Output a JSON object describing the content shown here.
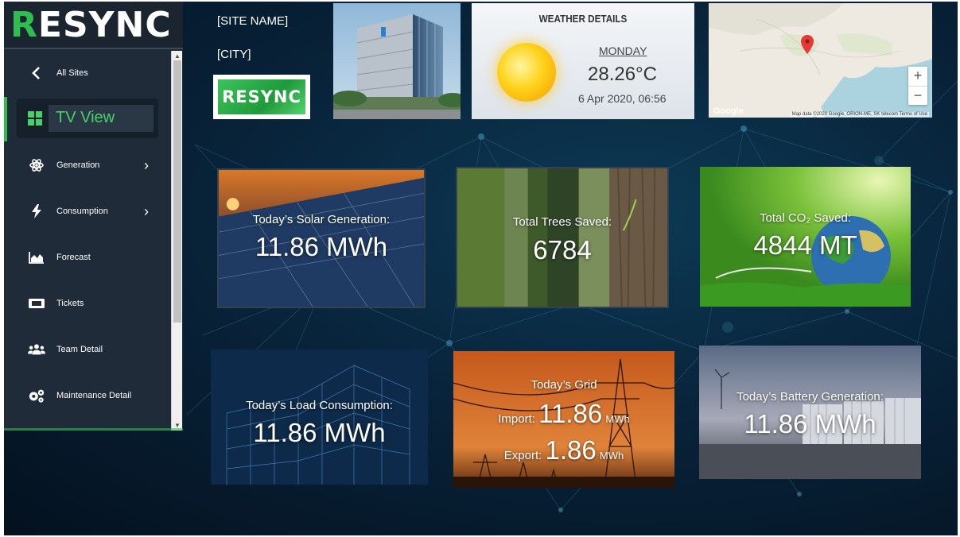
{
  "brand": {
    "logo_text": "RESYNC",
    "logo_first_letter": "R",
    "logo_rest": "ESYNC",
    "accent": "#2ebd4e"
  },
  "sidebar": {
    "items": [
      {
        "label": "All Sites",
        "icon": "chevron-left-icon"
      },
      {
        "label": "TV View",
        "icon": "grid-icon",
        "active": true
      },
      {
        "label": "Generation",
        "icon": "atom-icon",
        "has_submenu": true
      },
      {
        "label": "Consumption",
        "icon": "bolt-icon",
        "has_submenu": true
      },
      {
        "label": "Forecast",
        "icon": "area-chart-icon"
      },
      {
        "label": "Tickets",
        "icon": "ticket-icon"
      },
      {
        "label": "Team Detail",
        "icon": "users-icon"
      },
      {
        "label": "Maintenance Detail",
        "icon": "cogs-icon"
      }
    ]
  },
  "site": {
    "name": "[SITE NAME]",
    "city": "[CITY]",
    "logo_text": "RESYNC"
  },
  "weather": {
    "title": "WEATHER DETAILS",
    "day": "MONDAY",
    "temperature": "28.26°C",
    "datetime": "6 Apr 2020, 06:56",
    "icon": "sun-icon"
  },
  "map": {
    "google_label": "Google",
    "attribution": "Map data ©2020 Google, ORION-ME, SK telecom   Terms of Use",
    "zoom_in": "+",
    "zoom_out": "−"
  },
  "stats": {
    "solar": {
      "label": "Today’s Solar Generation:",
      "value": "11.86 MWh"
    },
    "trees": {
      "label": "Total Trees Saved:",
      "value": "6784"
    },
    "co2": {
      "label": "Total CO₂ Saved:",
      "value": "4844 MT"
    },
    "load": {
      "label": "Today’s Load Consumption:",
      "value": "11.86 MWh"
    },
    "grid": {
      "label": "Today’s Grid",
      "import_label": "Import:",
      "import_value": "11.86",
      "export_label": "Export:",
      "export_value": "1.86",
      "unit": "MWh"
    },
    "battery": {
      "label": "Today’s Battery Generation:",
      "value": "11.86 MWh"
    }
  }
}
